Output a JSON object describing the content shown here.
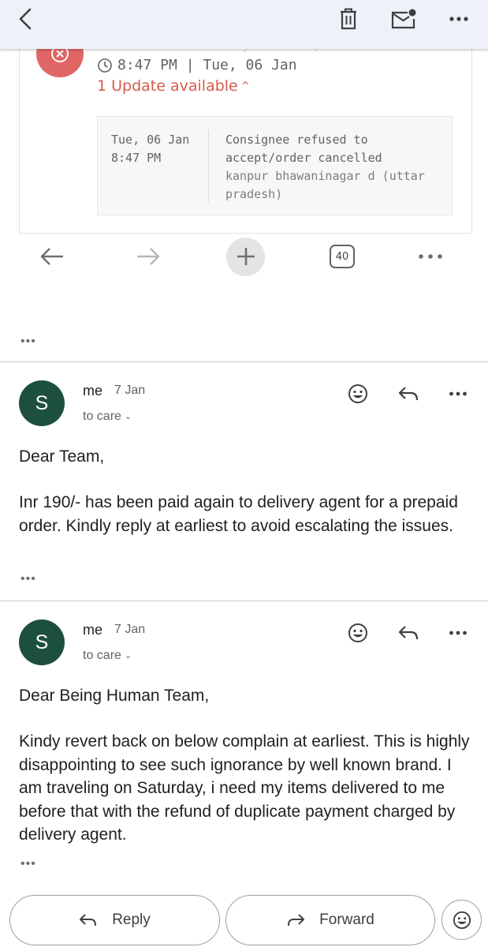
{
  "toolbar": {
    "back_icon": "chevron-left-icon",
    "delete_icon": "trash-icon",
    "mark_unread_icon": "mail-badge-icon",
    "more_icon": "more-horizontal-icon"
  },
  "delivery": {
    "faded_title": "Failed delivery attempt",
    "status_icon": "close-icon",
    "status_color": "#e06666",
    "time": "8:47 PM | Tue, 06 Jan",
    "update_link": "1 Update available",
    "update_color": "#d65b4a",
    "track": {
      "date_line1": "Tue, 06 Jan",
      "date_line2": "8:47 PM",
      "status": "Consignee refused to accept/order cancelled",
      "location": "kanpur bhawaninagar d (uttar pradesh)"
    }
  },
  "pager": {
    "count": "40"
  },
  "messages": [
    {
      "avatar_letter": "S",
      "avatar_color": "#1d4f3f",
      "sender": "me",
      "date": "7 Jan",
      "to": "to care",
      "greeting": "Dear Team,",
      "body": "Inr 190/- has been paid again to delivery agent for a prepaid order. Kindly reply at earliest to avoid escalating the issues."
    },
    {
      "avatar_letter": "S",
      "avatar_color": "#1d4f3f",
      "sender": "me",
      "date": "7 Jan",
      "to": "to care",
      "greeting": "Dear Being Human Team,",
      "body": "Kindy revert back on below complain at earliest. This is highly disappointing to see such ignorance by well known brand. I am traveling on Saturday, i need my items delivered to me before that with the refund of duplicate payment charged by delivery agent."
    }
  ],
  "bottom_bar": {
    "reply_label": "Reply",
    "forward_label": "Forward"
  },
  "ellipsis": "•••"
}
